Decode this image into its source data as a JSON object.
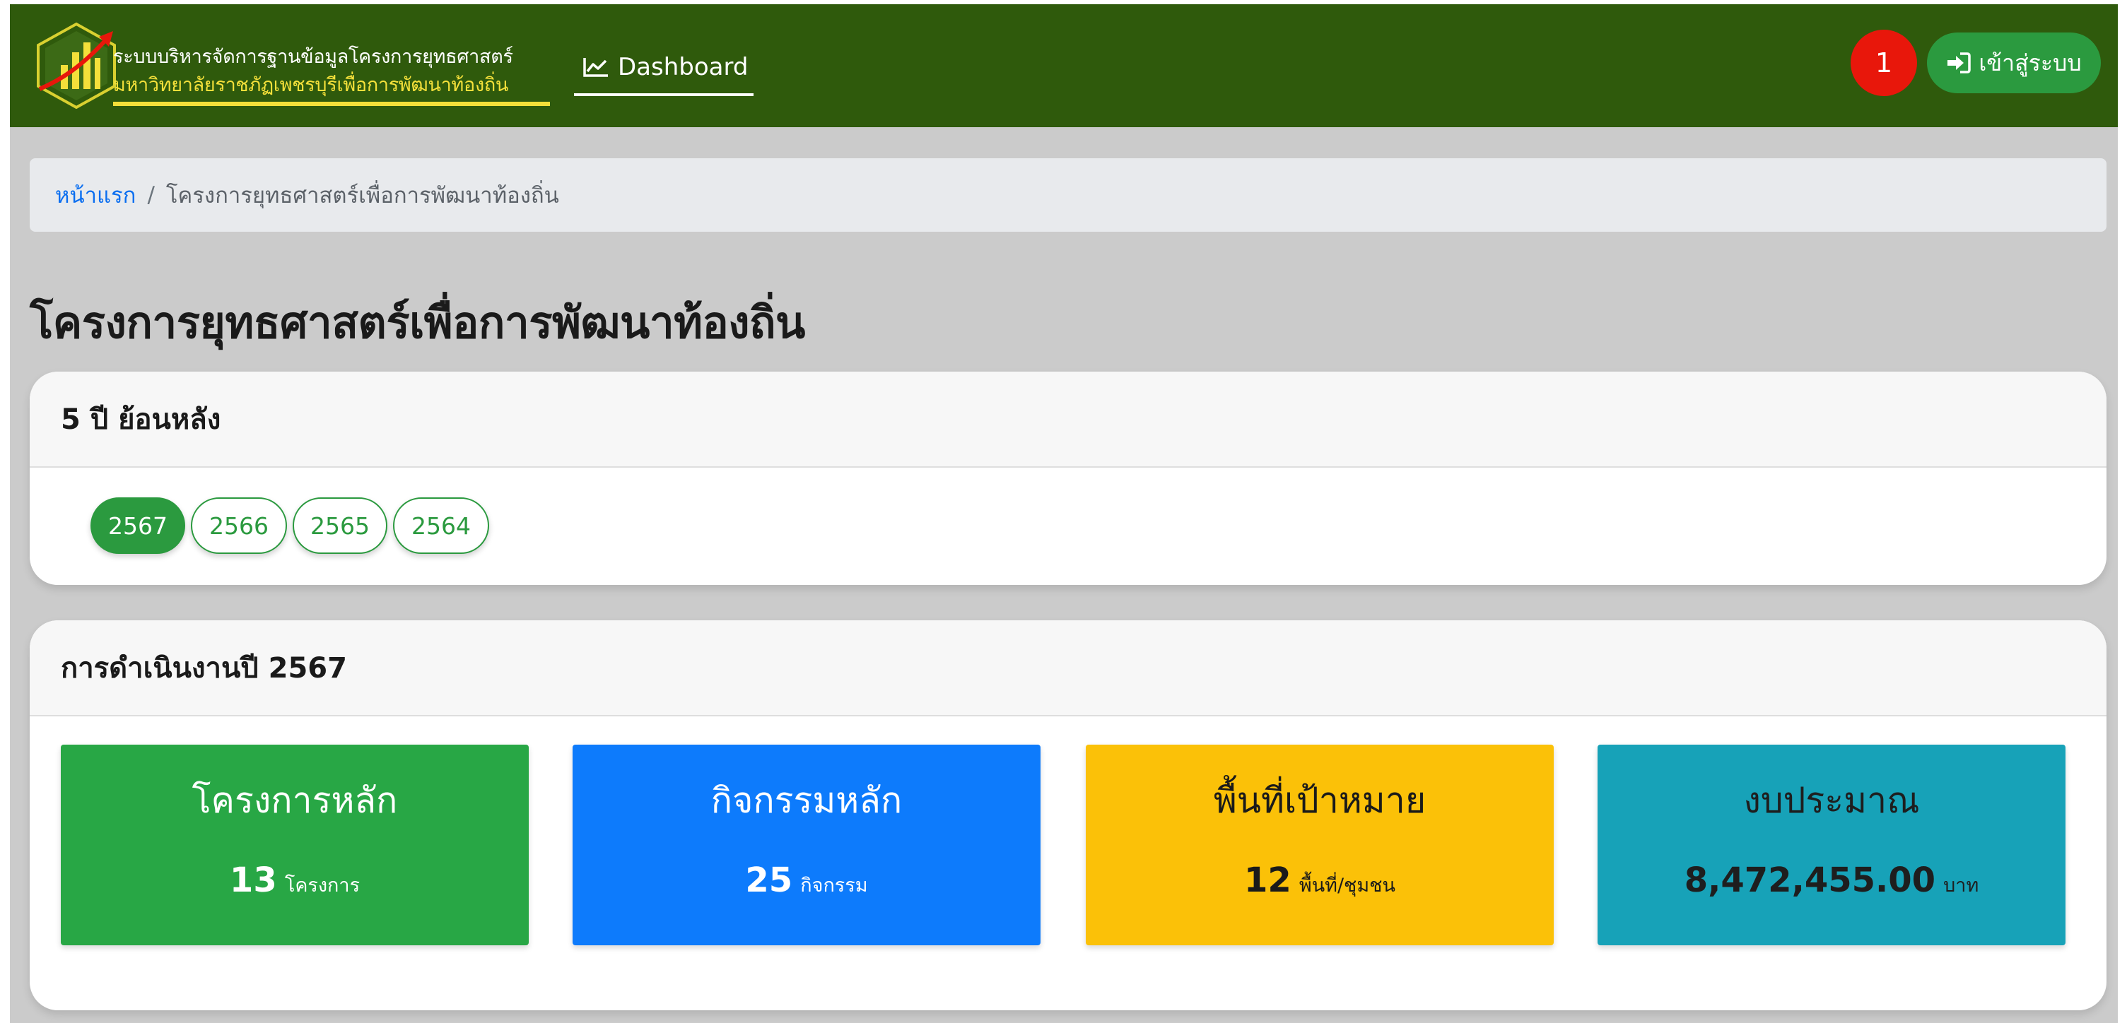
{
  "navbar": {
    "logo_line1": "ระบบบริหารจัดการฐานข้อมูลโครงการยุทธศาสตร์",
    "logo_line2": "มหาวิทยาลัยราชภัฏเพชรบุรีเพื่อการพัฒนาท้องถิ่น",
    "dashboard_label": "Dashboard",
    "dashboard_icon": "chart-line-icon",
    "badge_count": "1",
    "login_label": "เข้าสู่ระบบ",
    "login_icon": "sign-in-icon",
    "colors": {
      "background": "#2f5a0c",
      "logo_accent": "#f4e03a",
      "badge": "#e8170b",
      "login_button": "#2b9a3f"
    }
  },
  "breadcrumb": {
    "home": "หน้าแรก",
    "separator": "/",
    "current": "โครงการยุทธศาสตร์เพื่อการพัฒนาท้องถิ่น"
  },
  "page_title": "โครงการยุทธศาสตร์เพื่อการพัฒนาท้องถิ่น",
  "years_card": {
    "header": "5 ปี ย้อนหลัง",
    "years": [
      {
        "label": "2567",
        "active": true
      },
      {
        "label": "2566",
        "active": false
      },
      {
        "label": "2565",
        "active": false
      },
      {
        "label": "2564",
        "active": false
      }
    ]
  },
  "stats_card": {
    "header": "การดำเนินงานปี 2567",
    "stats": [
      {
        "title": "โครงการหลัก",
        "value": "13",
        "unit": "โครงการ",
        "color": "#28a745"
      },
      {
        "title": "กิจกรรมหลัก",
        "value": "25",
        "unit": "กิจกรรม",
        "color": "#0d7bfc"
      },
      {
        "title": "พื้นที่เป้าหมาย",
        "value": "12",
        "unit": "พื้นที่/ชุมชน",
        "color": "#fbc108"
      },
      {
        "title": "งบประมาณ",
        "value": "8,472,455.00",
        "unit": "บาท",
        "color": "#17a2b8"
      }
    ]
  }
}
